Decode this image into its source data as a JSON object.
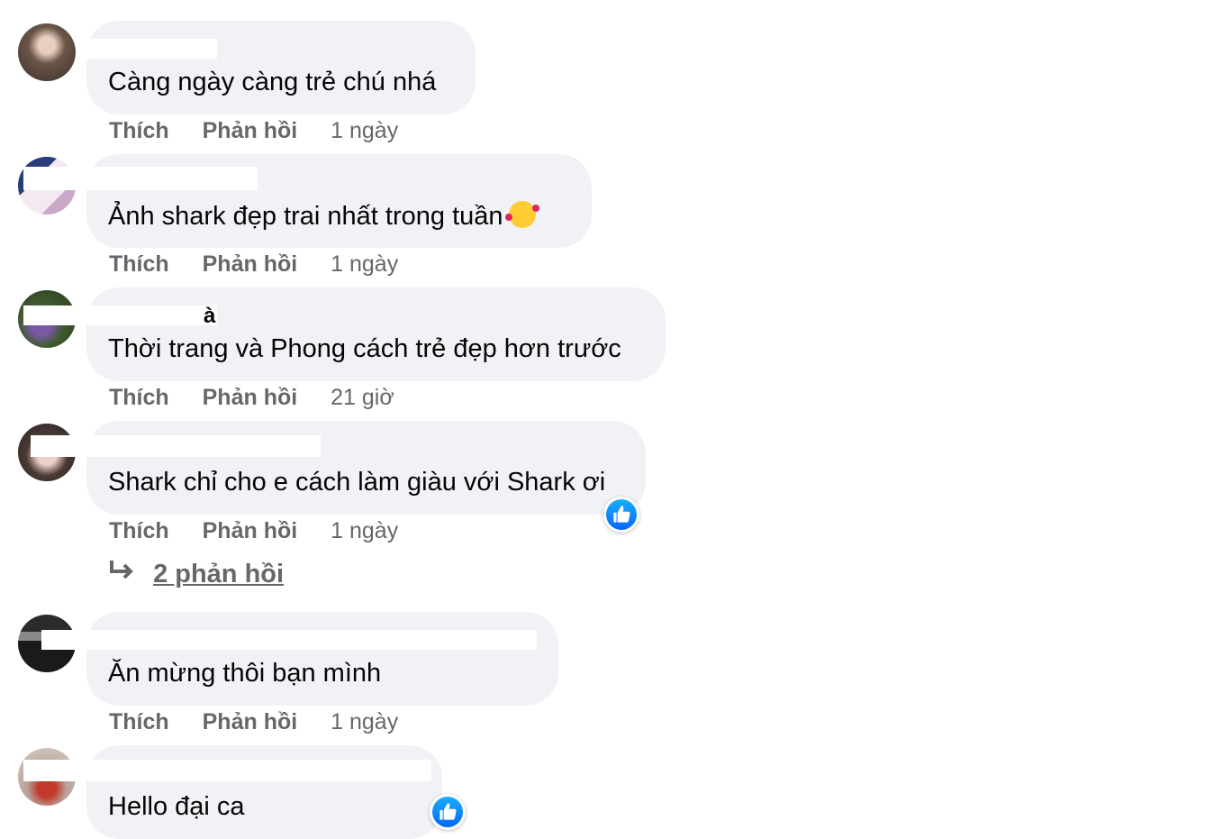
{
  "colors": {
    "bubble": "#f0f2f5",
    "action_text": "#65676b",
    "like_blue": "#0866ff",
    "follow_blue": "#216fdb"
  },
  "comments": [
    {
      "author": "",
      "follow": "",
      "text": "Càng ngày càng trẻ chú nhá",
      "like_label": "Thích",
      "reply_label": "Phản hồi",
      "time": "1 ngày",
      "avatar_colors": [
        "#6b5548",
        "#c9b2a2"
      ]
    },
    {
      "author": "",
      "follow": "",
      "text": "Ảnh shark đẹp trai nhất trong tuần",
      "emoji": "smiling-face-with-hearts-icon",
      "like_label": "Thích",
      "reply_label": "Phản hồi",
      "time": "1 ngày",
      "avatar_colors": [
        "#2a3c7a",
        "#e8d9e4"
      ]
    },
    {
      "author": "à",
      "follow": "",
      "text": "Thời trang và Phong cách trẻ đẹp hơn trước",
      "like_label": "Thích",
      "reply_label": "Phản hồi",
      "time": "21 giờ",
      "avatar_colors": [
        "#3f5a30",
        "#7a5aa8"
      ]
    },
    {
      "author": "",
      "follow": "",
      "text": "Shark chỉ cho e cách làm giàu với Shark ơi",
      "like_label": "Thích",
      "reply_label": "Phản hồi",
      "time": "1 ngày",
      "avatar_colors": [
        "#4a3a36",
        "#e6c9bf"
      ],
      "replies_label": "2 phản hồi"
    },
    {
      "author": "",
      "follow": "",
      "text": "Ăn mừng thôi bạn mình",
      "like_label": "Thích",
      "reply_label": "Phản hồi",
      "time": "1 ngày",
      "avatar_colors": [
        "#1e1e1e",
        "#8a8a8a"
      ]
    },
    {
      "author": "",
      "follow": "",
      "text": "Hello đại ca",
      "avatar_colors": [
        "#b9a39a",
        "#c0392b"
      ]
    }
  ]
}
